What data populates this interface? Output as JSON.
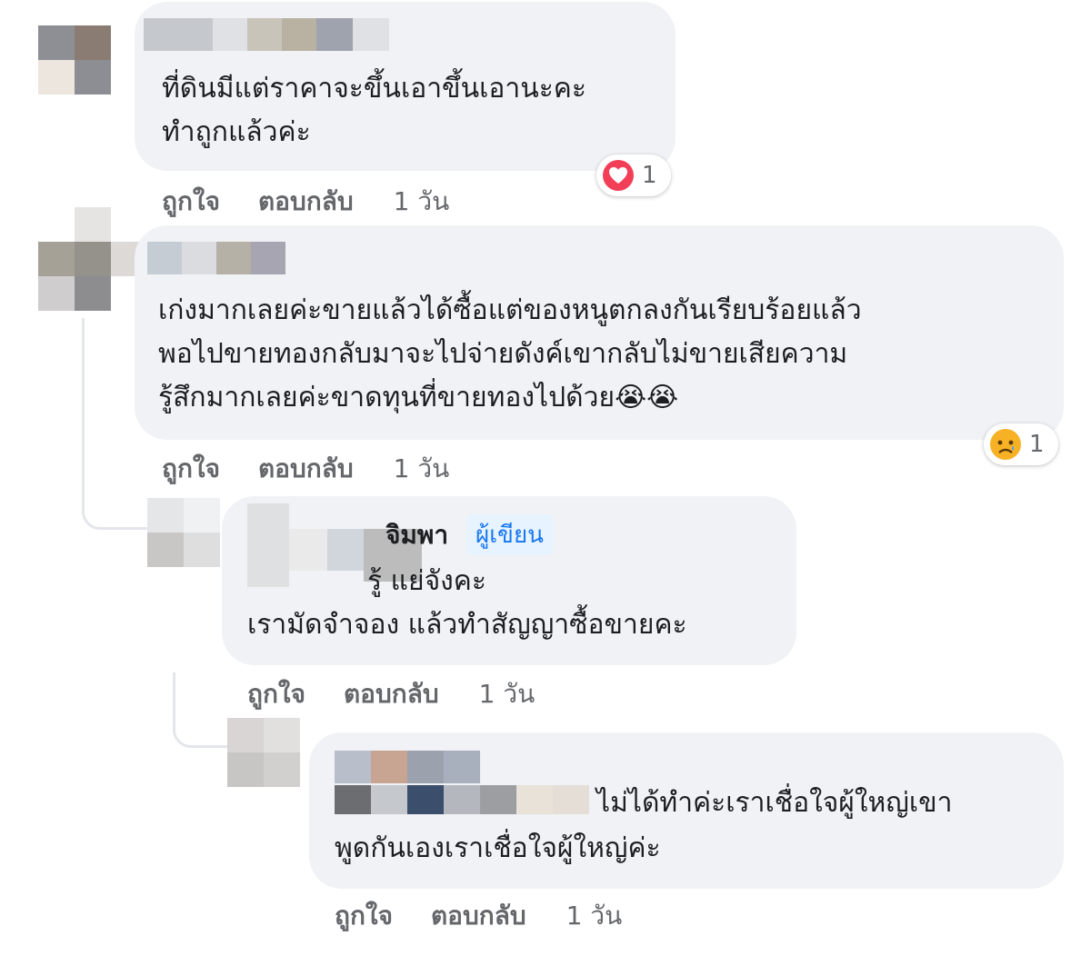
{
  "comments": [
    {
      "text_lines": [
        "ที่ดินมีแต่ราคาจะขึ้นเอาขึ้นเอานะคะ",
        "ทำถูกแล้วค่ะ"
      ],
      "like_label": "ถูกใจ",
      "reply_label": "ตอบกลับ",
      "time": "1 วัน",
      "reaction": {
        "icon": "heart-reaction-icon",
        "count": "1"
      }
    },
    {
      "text_lines": [
        "เก่งมากเลยค่ะขายแล้วได้ซื้อแต่ของหนูตกลงกันเรียบร้อยแล้ว",
        "พอไปขายทองกลับมาจะไปจ่ายดังค์เขากลับไม่ขายเสียความ",
        "รู้สึกมากเลยค่ะขาดทุนที่ขายทองไปด้วย"
      ],
      "emoji": "😭😭",
      "like_label": "ถูกใจ",
      "reply_label": "ตอบกลับ",
      "time": "1 วัน",
      "reaction": {
        "icon": "sad-reaction-icon",
        "count": "1"
      }
    },
    {
      "name_suffix": "จิมพา",
      "badge": "ผู้เขียน",
      "text_lines": [
        "รู้ แย่จังคะ",
        "เรามัดจำจอง แล้วทำสัญญาซื้อขายคะ"
      ],
      "like_label": "ถูกใจ",
      "reply_label": "ตอบกลับ",
      "time": "1 วัน"
    },
    {
      "text_lines": [
        "ไม่ได้ทำค่ะเราเชื่อใจผู้ใหญ่เขา",
        "พูดกันเองเราเชื่อใจผู้ใหญ่ค่ะ"
      ],
      "like_label": "ถูกใจ",
      "reply_label": "ตอบกลับ",
      "time": "1 วัน"
    }
  ],
  "colors": {
    "bubble": "#f0f2f5",
    "meta": "#65676b",
    "heart": "#f33e58",
    "sad": "#f7b125",
    "badge_text": "#1877f2"
  }
}
